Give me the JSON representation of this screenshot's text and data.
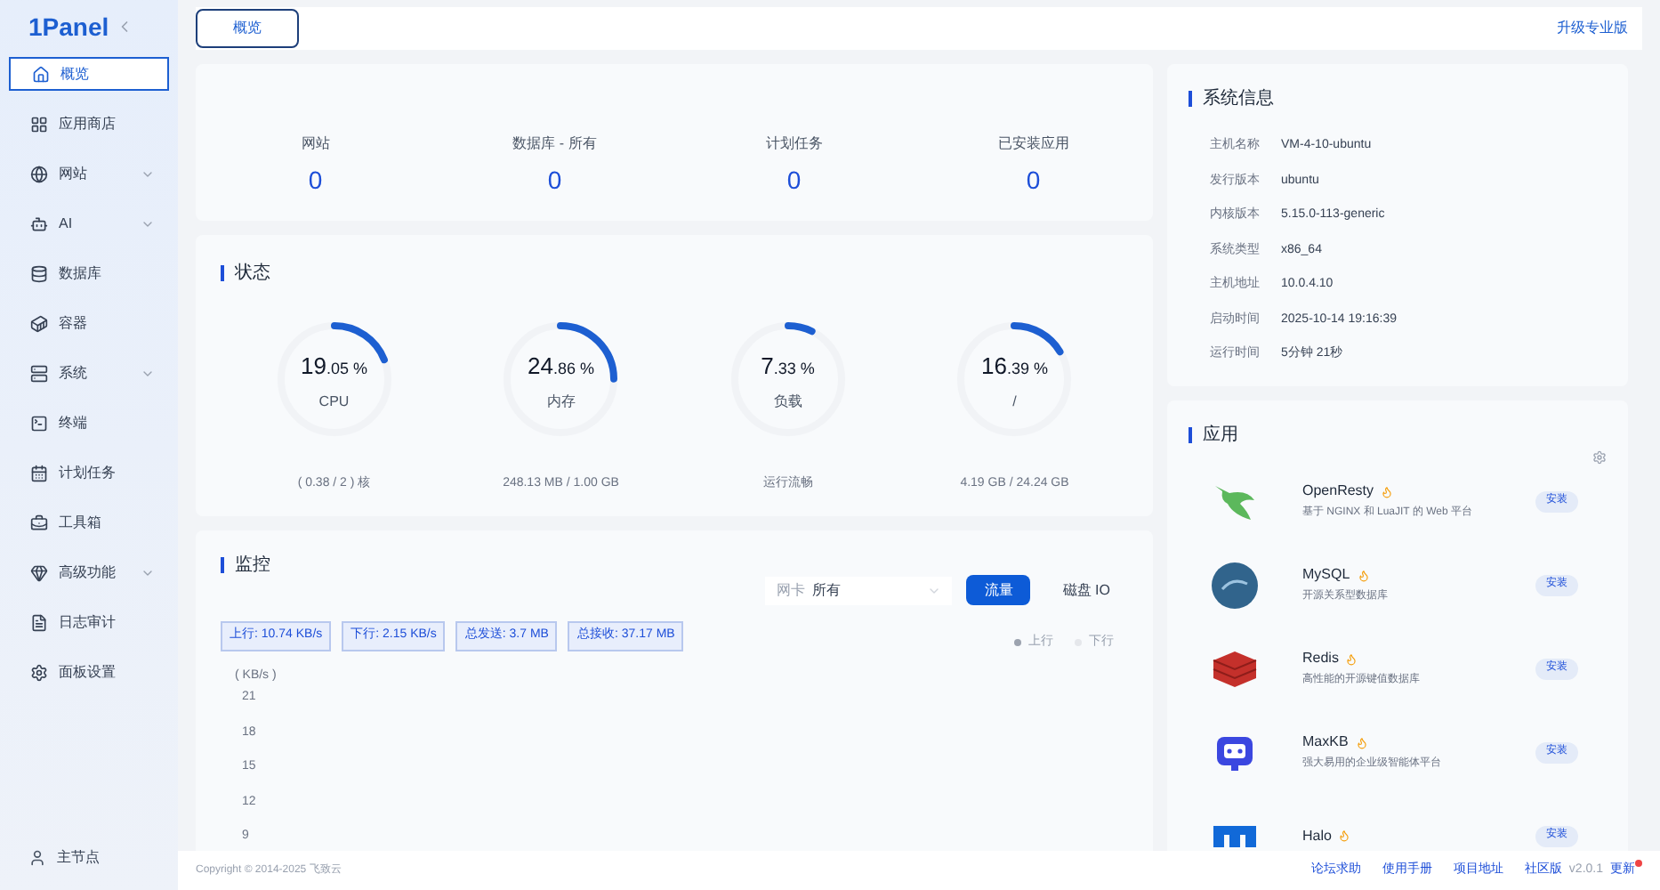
{
  "logo": {
    "name": "1Panel"
  },
  "sidebar": {
    "items": [
      {
        "label": "概览",
        "selected": true,
        "expandable": false
      },
      {
        "label": "应用商店",
        "selected": false,
        "expandable": false
      },
      {
        "label": "网站",
        "selected": false,
        "expandable": true
      },
      {
        "label": "AI",
        "selected": false,
        "expandable": true
      },
      {
        "label": "数据库",
        "selected": false,
        "expandable": false
      },
      {
        "label": "容器",
        "selected": false,
        "expandable": false
      },
      {
        "label": "系统",
        "selected": false,
        "expandable": true
      },
      {
        "label": "终端",
        "selected": false,
        "expandable": false
      },
      {
        "label": "计划任务",
        "selected": false,
        "expandable": false
      },
      {
        "label": "工具箱",
        "selected": false,
        "expandable": false
      },
      {
        "label": "高级功能",
        "selected": false,
        "expandable": true
      },
      {
        "label": "日志审计",
        "selected": false,
        "expandable": false
      },
      {
        "label": "面板设置",
        "selected": false,
        "expandable": false
      }
    ],
    "node": "主节点"
  },
  "tabs": [
    {
      "label": "概览",
      "selected": true
    }
  ],
  "upgrade_link": "升级专业版",
  "overview": {
    "stats": [
      {
        "label": "网站",
        "value": "0"
      },
      {
        "label": "数据库 - 所有",
        "value": "0"
      },
      {
        "label": "计划任务",
        "value": "0"
      },
      {
        "label": "已安装应用",
        "value": "0"
      }
    ]
  },
  "status": {
    "title": "状态",
    "gauges": [
      {
        "major": "19",
        "minor": ".05 %",
        "label": "CPU",
        "detail": "( 0.38 / 2 ) 核",
        "level": 0.1905
      },
      {
        "major": "24",
        "minor": ".86 %",
        "label": "内存",
        "detail": "248.13 MB / 1.00 GB",
        "level": 0.2486
      },
      {
        "major": "7",
        "minor": ".33 %",
        "label": "负载",
        "detail": "运行流畅",
        "level": 0.0733
      },
      {
        "major": "16",
        "minor": ".39 %",
        "label": "/",
        "detail": "4.19 GB / 24.24 GB",
        "level": 0.1639
      }
    ]
  },
  "monitor": {
    "title": "监控",
    "nic_label": "网卡",
    "nic_value": "所有",
    "modes": [
      {
        "label": "流量",
        "selected": true
      },
      {
        "label": "磁盘 IO",
        "selected": false
      }
    ],
    "tags": [
      "上行: 10.74 KB/s",
      "下行: 2.15 KB/s",
      "总发送: 3.7 MB",
      "总接收: 37.17 MB"
    ],
    "legend": [
      {
        "label": "上行",
        "color": "#9ca3af"
      },
      {
        "label": "下行",
        "color": "#e5e7eb"
      }
    ],
    "unit": "( KB/s )",
    "yticks": [
      "21",
      "18",
      "15",
      "12",
      "9"
    ]
  },
  "system_info": {
    "title": "系统信息",
    "rows": [
      {
        "key": "主机名称",
        "value": "VM-4-10-ubuntu"
      },
      {
        "key": "发行版本",
        "value": "ubuntu"
      },
      {
        "key": "内核版本",
        "value": "5.15.0-113-generic"
      },
      {
        "key": "系统类型",
        "value": "x86_64"
      },
      {
        "key": "主机地址",
        "value": "10.0.4.10"
      },
      {
        "key": "启动时间",
        "value": "2025-10-14 19:16:39"
      },
      {
        "key": "运行时间",
        "value": "5分钟 21秒"
      }
    ]
  },
  "apps": {
    "title": "应用",
    "items": [
      {
        "name": "OpenResty",
        "desc": "基于 NGINX 和 LuaJIT 的 Web 平台",
        "action": "安装"
      },
      {
        "name": "MySQL",
        "desc": "开源关系型数据库",
        "action": "安装"
      },
      {
        "name": "Redis",
        "desc": "高性能的开源键值数据库",
        "action": "安装"
      },
      {
        "name": "MaxKB",
        "desc": "强大易用的企业级智能体平台",
        "action": "安装"
      },
      {
        "name": "Halo",
        "action": "安装"
      }
    ]
  },
  "footer": {
    "copyright": "Copyright © 2014-2025 飞致云",
    "links": [
      "论坛求助",
      "使用手册",
      "项目地址",
      "社区版"
    ],
    "version": "v2.0.1",
    "update": "更新",
    "update_badge": true
  }
}
